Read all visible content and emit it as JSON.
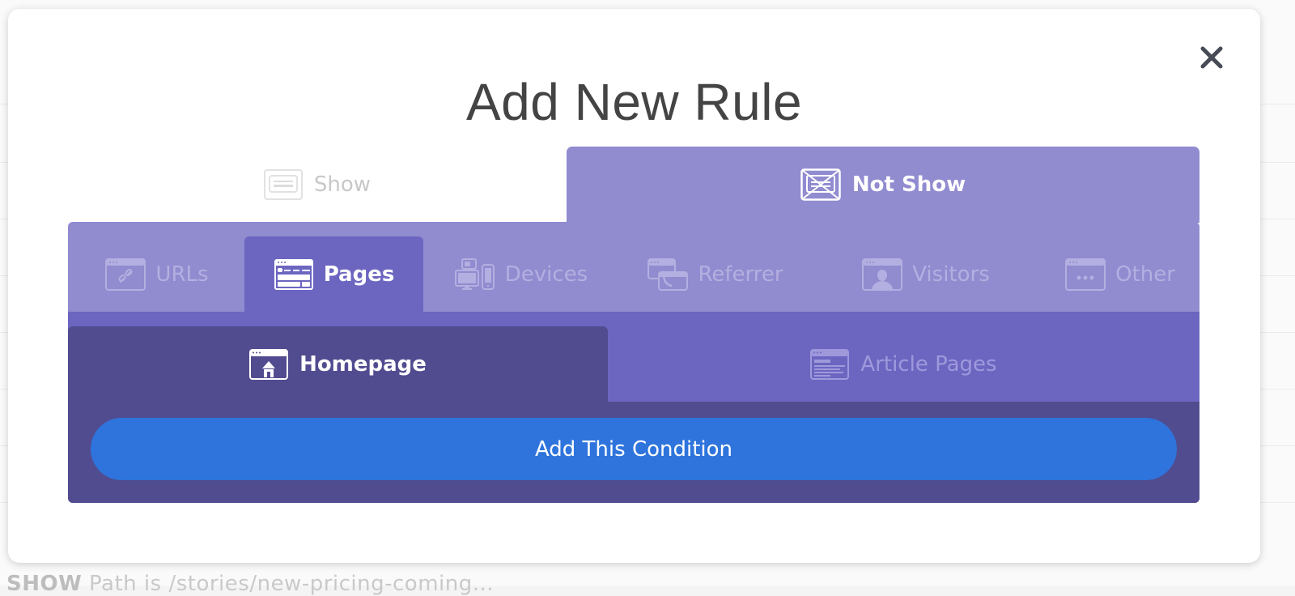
{
  "background": {
    "footer_keyword": "SHOW",
    "footer_text": "Path is /stories/new-pricing-coming..."
  },
  "modal": {
    "title": "Add New Rule",
    "close_icon": "close-icon"
  },
  "mode_tabs": [
    {
      "label": "Show",
      "icon": "show-window-icon",
      "active": false
    },
    {
      "label": "Not Show",
      "icon": "not-show-window-icon",
      "active": true
    }
  ],
  "category_tabs": [
    {
      "label": "URLs",
      "icon": "link-window-icon",
      "active": false
    },
    {
      "label": "Pages",
      "icon": "pages-window-icon",
      "active": true
    },
    {
      "label": "Devices",
      "icon": "devices-icon",
      "active": false
    },
    {
      "label": "Referrer",
      "icon": "referrer-icon",
      "active": false
    },
    {
      "label": "Visitors",
      "icon": "visitor-window-icon",
      "active": false
    },
    {
      "label": "Other",
      "icon": "more-window-icon",
      "active": false
    }
  ],
  "page_options": [
    {
      "label": "Homepage",
      "icon": "home-window-icon",
      "active": true
    },
    {
      "label": "Article Pages",
      "icon": "article-window-icon",
      "active": false
    }
  ],
  "action": {
    "add_condition_label": "Add This Condition"
  },
  "colors": {
    "not_show_tab": "#918bd0",
    "active_category": "#6c66c1",
    "active_option": "#514c90",
    "button_blue": "#2e74dc",
    "title_text": "#444444"
  }
}
